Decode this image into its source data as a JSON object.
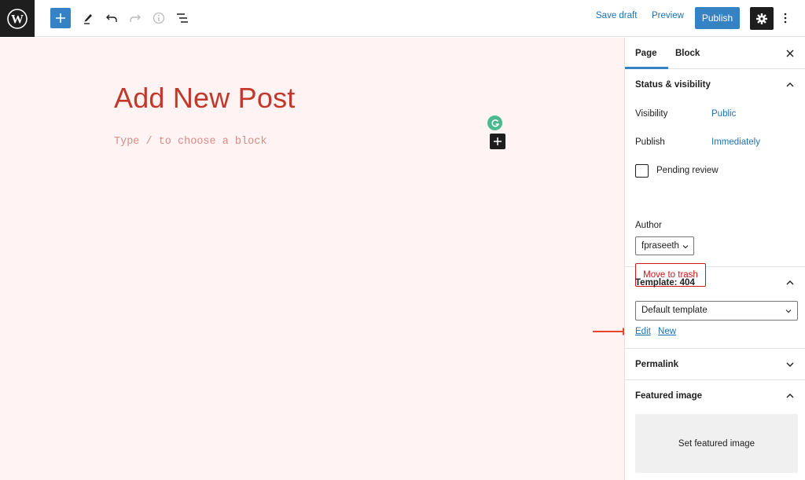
{
  "topbar": {
    "save_draft": "Save draft",
    "preview": "Preview",
    "publish": "Publish"
  },
  "editor": {
    "title": "Add New Post",
    "block_placeholder": "Type / to choose a block"
  },
  "sidebar": {
    "tabs": [
      {
        "label": "Page",
        "active": true
      },
      {
        "label": "Block",
        "active": false
      }
    ],
    "status_visibility": {
      "heading": "Status & visibility",
      "visibility_label": "Visibility",
      "visibility_value": "Public",
      "publish_label": "Publish",
      "publish_value": "Immediately",
      "pending_review_label": "Pending review",
      "pending_review_checked": false,
      "author_label": "Author",
      "author_value": "fpraseeth",
      "trash_label": "Move to trash"
    },
    "template": {
      "heading": "Template: 404",
      "selected": "Default template",
      "edit_link": "Edit",
      "new_link": "New"
    },
    "permalink": {
      "heading": "Permalink"
    },
    "featured_image": {
      "heading": "Featured image",
      "set_label": "Set featured image"
    }
  },
  "colors": {
    "accent": "#3582c4",
    "link": "#2271b1",
    "danger": "#cc1818",
    "title": "#c0392b",
    "editor_bg": "#fff3f4",
    "annotation_arrow": "#e8452c"
  }
}
